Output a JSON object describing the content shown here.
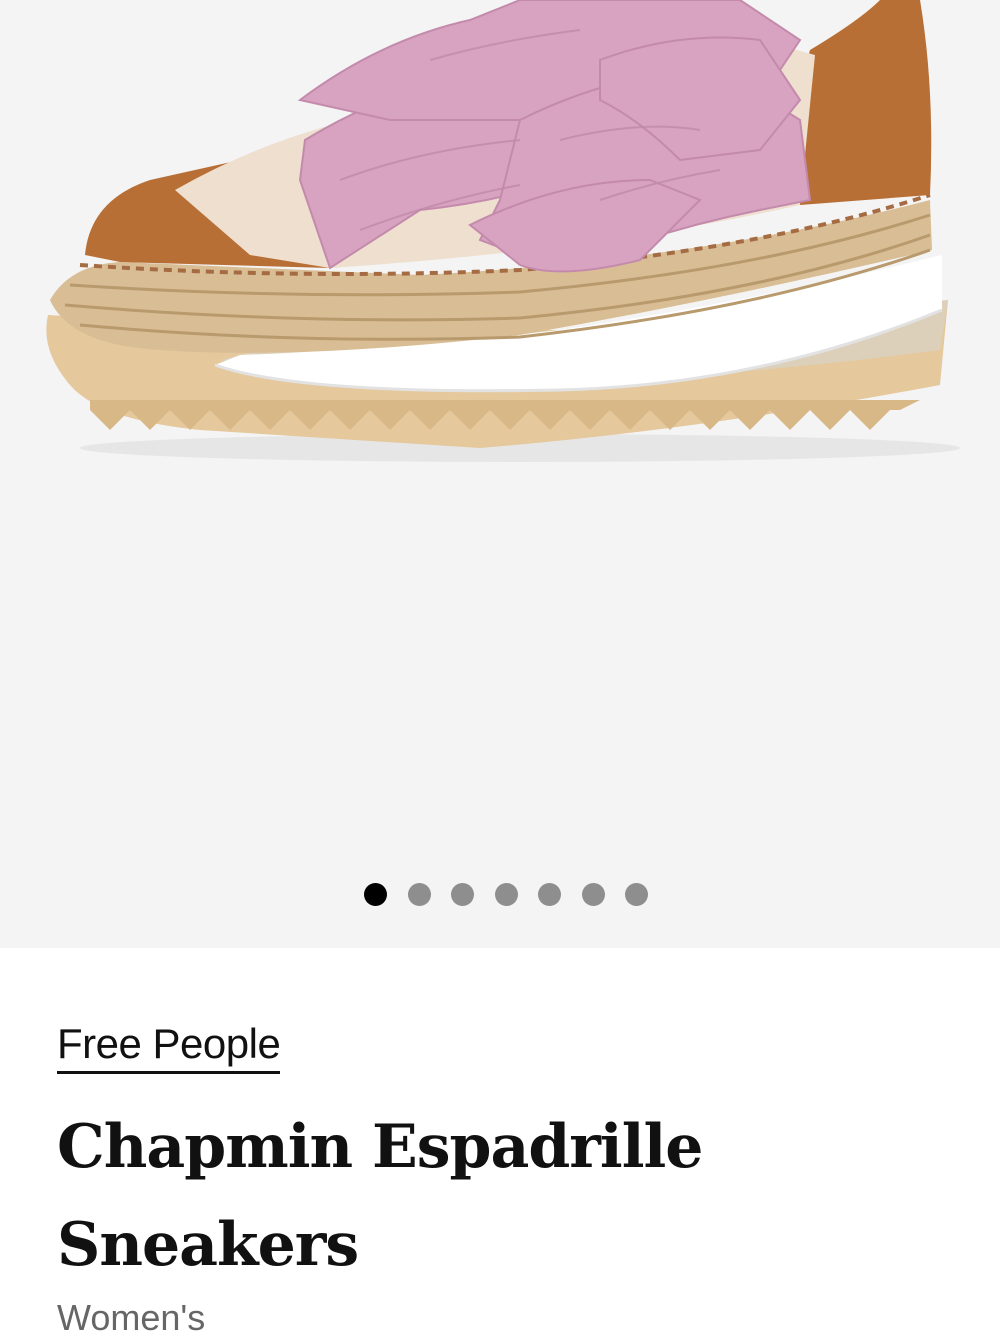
{
  "gallery": {
    "image": "espadrille-sneaker-photo",
    "dot_count": 7,
    "active_index": 0
  },
  "product": {
    "brand": "Free People",
    "title": "Chapmin Espadrille Sneakers",
    "gender": "Women's"
  },
  "colors": {
    "gallery_background": "#f4f4f4",
    "dot_active": "#000000",
    "dot_inactive": "#8e8e8e",
    "ribbon_pink": "#d7a3c0",
    "suede_tan": "#b86f35",
    "jute": "#d8bd94"
  }
}
